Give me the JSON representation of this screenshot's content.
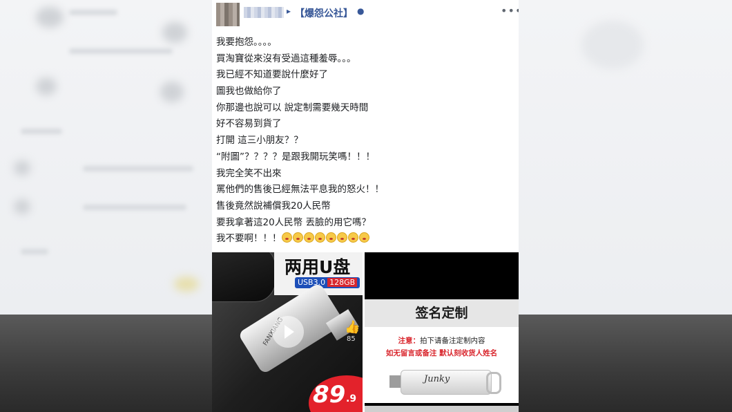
{
  "post": {
    "author_arrow": "▸",
    "group": "【爆怨公社】",
    "group_dot": "●",
    "more": "•••"
  },
  "lines": [
    "我要抱怨。。。。",
    "買淘寶從來沒有受過這種羞辱。。。",
    "我已經不知道要說什麼好了",
    "圖我也做給你了",
    "你那邊也說可以 說定制需要幾天時間",
    "好不容易到貨了",
    "打開 這三小朋友？？",
    "“附圖”？？？？是跟我開玩笑嗎！！！",
    "我完全笑不出來",
    "罵他們的售後已經無法平息我的怒火！！",
    "售後竟然說補償我20人民幣",
    "要我拿著這20人民幣 丟臉的用它嗎？"
  ],
  "last_line": "我不要啊！！！",
  "emoji_count": 8,
  "photo_left": {
    "title": "两用U盘",
    "spec": "USB3.0",
    "capacity": "128GB",
    "brand": "FANXIANG",
    "likes": "85",
    "price": "89",
    "price_decimal": ".9"
  },
  "photo_right": {
    "title": "签名定制",
    "note_label": "注意：",
    "note_text": "拍下请备注定制内容",
    "note2": "如无留言或备注  默认刻收货人姓名",
    "signature": "Junky"
  },
  "colors": {
    "link": "#385898",
    "price_red": "#e3222b",
    "badge_blue": "#1d4fb8"
  }
}
